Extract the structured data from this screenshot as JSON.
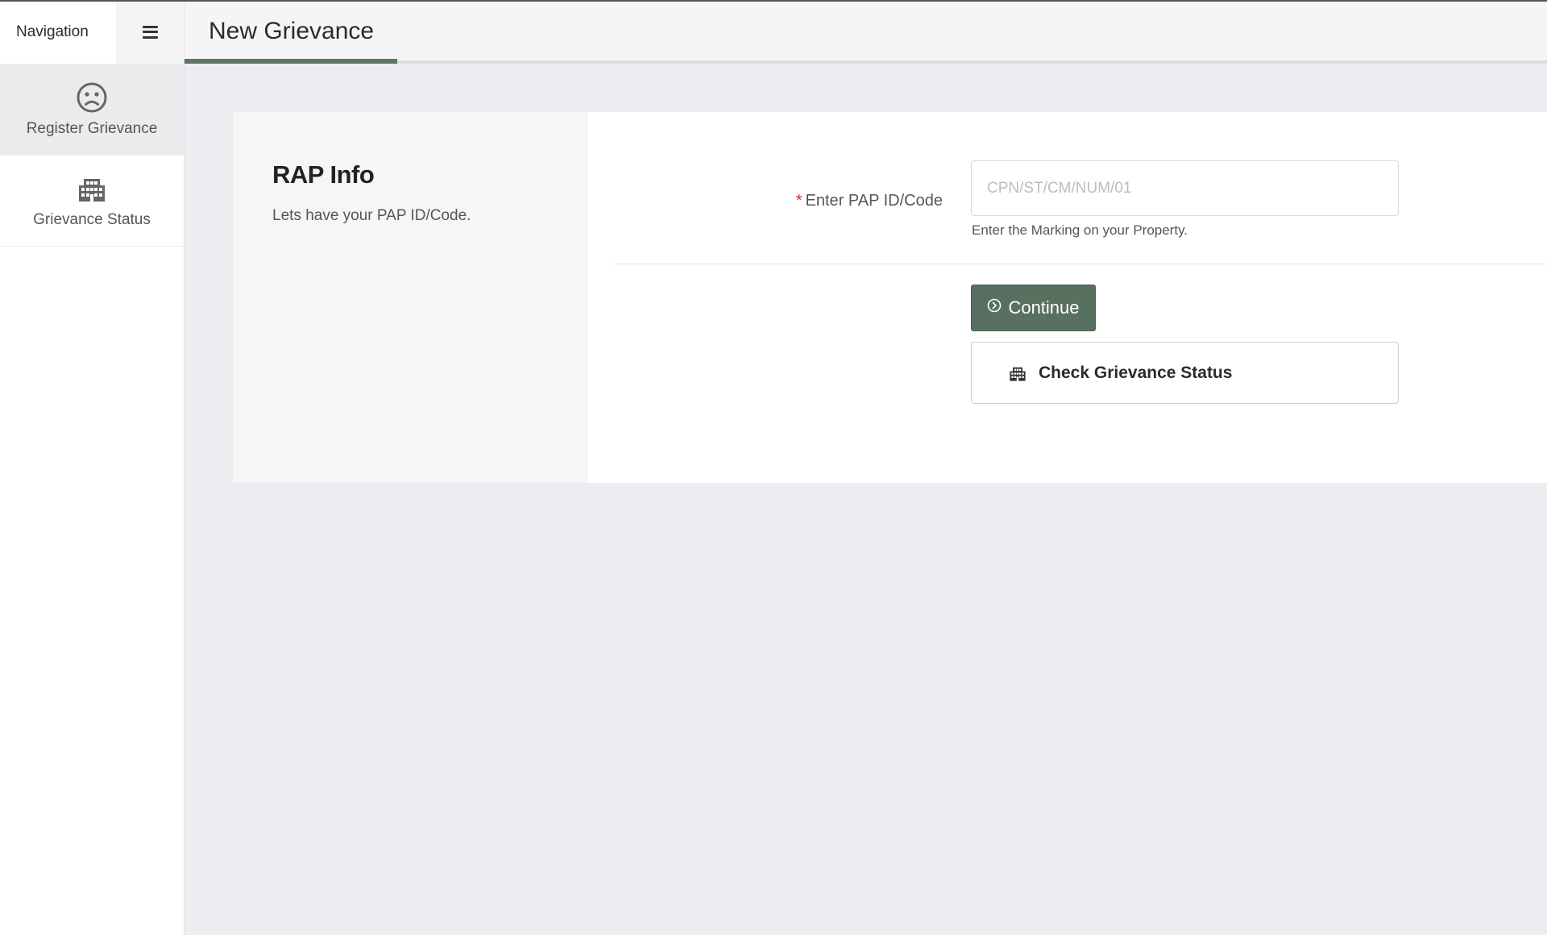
{
  "sidebar": {
    "title": "Navigation",
    "items": [
      {
        "label": "Register Grievance",
        "icon": "frown-icon",
        "active": true
      },
      {
        "label": "Grievance Status",
        "icon": "building-icon",
        "active": false
      }
    ]
  },
  "header": {
    "title": "New Grievance"
  },
  "section": {
    "title": "RAP Info",
    "subtitle": "Lets have your PAP ID/Code."
  },
  "form": {
    "pap_label": "Enter PAP ID/Code",
    "required_marker": "*",
    "pap_placeholder": "CPN/ST/CM/NUM/01",
    "pap_value": "",
    "help_text": "Enter the Marking on your Property."
  },
  "actions": {
    "continue_label": "Continue",
    "check_status_label": "Check Grievance Status"
  },
  "colors": {
    "accent": "#587060",
    "tab_underline": "#5e7563",
    "required": "#d9252b",
    "background": "#ebedf0"
  }
}
